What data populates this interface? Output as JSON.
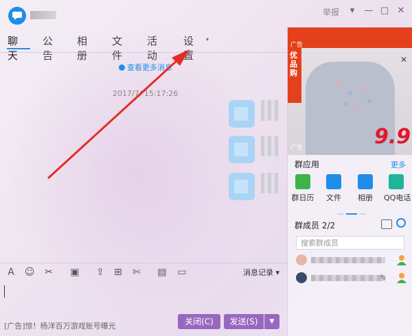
{
  "titlebar": {
    "report_label": "举报",
    "menu_icon": "chevron-down-icon",
    "minimize_icon": "minimize-icon",
    "maximize_icon": "maximize-icon",
    "close_icon": "close-icon"
  },
  "tabs": [
    {
      "label": "聊天",
      "active": true
    },
    {
      "label": "公告"
    },
    {
      "label": "相册"
    },
    {
      "label": "文件"
    },
    {
      "label": "活动"
    },
    {
      "label": "设置"
    }
  ],
  "chat": {
    "history_link": "查看更多消息",
    "timestamp": "2017/7/  15:17:26"
  },
  "toolbar": {
    "message_log": "消息记录",
    "tools": [
      "font-icon",
      "emoji-icon",
      "screenshot-icon",
      "image-icon",
      "upload-icon",
      "gift-icon",
      "scissors-icon",
      "calendar-icon",
      "chat-record-icon"
    ]
  },
  "footer": {
    "ad_text": "[广告]惊！杨洋百万游戏账号曝光",
    "close_label": "关闭(C)",
    "send_label": "发送(S)"
  },
  "sidebar": {
    "ad_badge": "广告",
    "ad_vertical_text": "优品购",
    "ad_price": "9.9",
    "ad_badge_bottom": "广告",
    "apps_title": "群应用",
    "more_label": "更多",
    "apps": [
      {
        "label": "群日历",
        "color": "#3db34a"
      },
      {
        "label": "文件",
        "color": "#1e8ee8"
      },
      {
        "label": "相册",
        "color": "#1e8ee8"
      },
      {
        "label": "QQ电话",
        "color": "#1fb59b"
      }
    ],
    "members_title": "群成员 2/2",
    "member_search_placeholder": "搜索群成员"
  },
  "colors": {
    "accent": "#1e8ee8",
    "button_purple": "#9868c0",
    "arrow_red": "#e62a25"
  }
}
